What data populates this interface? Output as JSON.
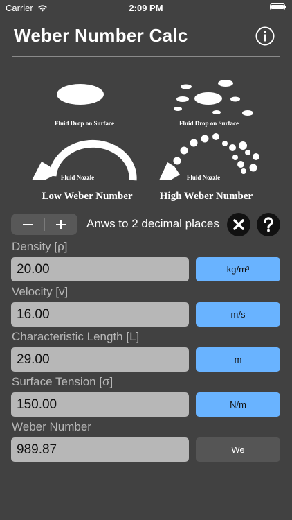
{
  "status_bar": {
    "carrier": "Carrier",
    "time": "2:09 PM"
  },
  "header": {
    "title": "Weber Number Calc"
  },
  "illustration": {
    "low": {
      "drop_caption": "Fluid Drop on Surface",
      "nozzle_caption": "Fluid Nozzle",
      "title": "Low Weber Number"
    },
    "high": {
      "drop_caption": "Fluid Drop on Surface",
      "nozzle_caption": "Fluid Nozzle",
      "title": "High Weber Number"
    }
  },
  "controls": {
    "minus": "−",
    "plus": "+",
    "decimals_text": "Anws to 2 decimal places"
  },
  "inputs": [
    {
      "label": "Density [ρ]",
      "value": "20.00",
      "unit": "kg/m³"
    },
    {
      "label": "Velocity [v]",
      "value": "16.00",
      "unit": "m/s"
    },
    {
      "label": "Characteristic Length [L]",
      "value": "29.00",
      "unit": "m"
    },
    {
      "label": "Surface Tension [σ]",
      "value": "150.00",
      "unit": "N/m"
    }
  ],
  "result": {
    "label": "Weber Number",
    "value": "989.87",
    "unit": "We"
  },
  "colors": {
    "background": "#414141",
    "unit_button": "#69b3ff",
    "field": "#b7b7b7"
  }
}
